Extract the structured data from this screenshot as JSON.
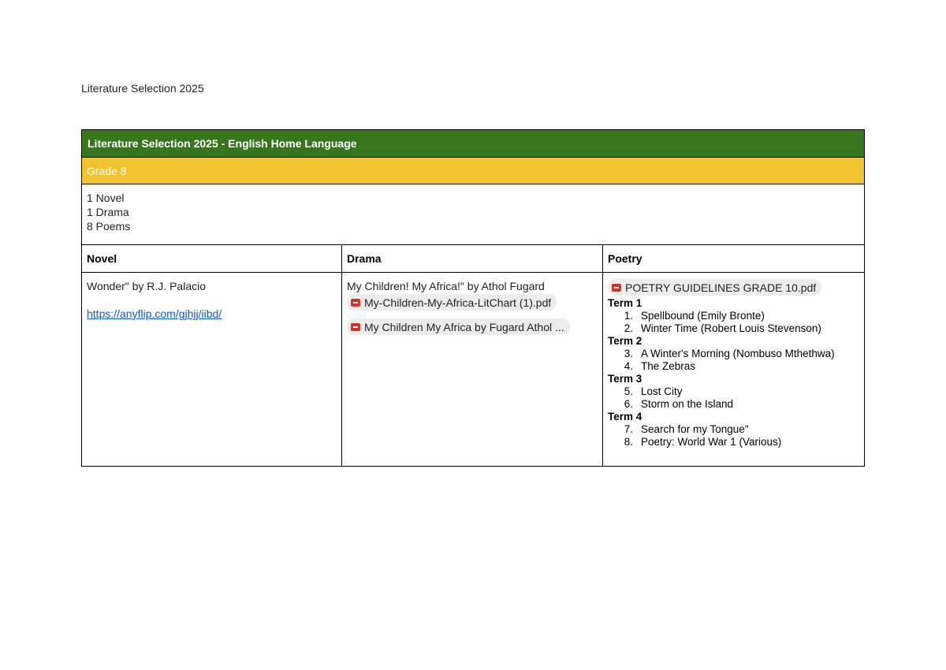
{
  "document": {
    "title": "Literature Selection 2025"
  },
  "table": {
    "header": "Literature Selection 2025 - English Home Language",
    "grade": "Grade 8",
    "summary": [
      "1 Novel",
      "1 Drama",
      "8 Poems"
    ],
    "columns": [
      "Novel",
      "Drama",
      "Poetry"
    ],
    "novel": {
      "title": "Wonder\" by R.J. Palacio",
      "link": "https://anyflip.com/gjhjj/iibd/"
    },
    "drama": {
      "title": "My Children! My Africa!\" by Athol Fugard",
      "files": [
        {
          "name": "My-Children-My-Africa-LitChart (1).pdf",
          "icon": "pdf-icon"
        },
        {
          "name": "My Children My Africa by Fugard Athol ...",
          "icon": "pdf-icon"
        }
      ]
    },
    "poetry": {
      "file": {
        "name": "POETRY GUIDELINES GRADE 10.pdf",
        "icon": "pdf-icon"
      },
      "terms": [
        {
          "label": "Term 1",
          "poems": [
            {
              "num": "1.",
              "title": "Spellbound (Emily Bronte)"
            },
            {
              "num": "2.",
              "title": "Winter Time (Robert Louis Stevenson)"
            }
          ]
        },
        {
          "label": "Term 2",
          "poems": [
            {
              "num": "3.",
              "title": "A Winter's Morning (Nombuso Mthethwa)"
            },
            {
              "num": "4.",
              "title": "The Zebras"
            }
          ]
        },
        {
          "label": "Term 3",
          "poems": [
            {
              "num": "5.",
              "title": "Lost City"
            },
            {
              "num": "6.",
              "title": "Storm on the Island"
            }
          ]
        },
        {
          "label": "Term 4",
          "poems": [
            {
              "num": "7.",
              "title": "Search for my Tongue\""
            },
            {
              "num": "8.",
              "title": "Poetry: World War 1 (Various)"
            }
          ]
        }
      ]
    },
    "colors": {
      "header_bg": "#38761d",
      "grade_bg": "#f1c232",
      "link": "#1155cc",
      "pdf_icon": "#d93025"
    }
  }
}
